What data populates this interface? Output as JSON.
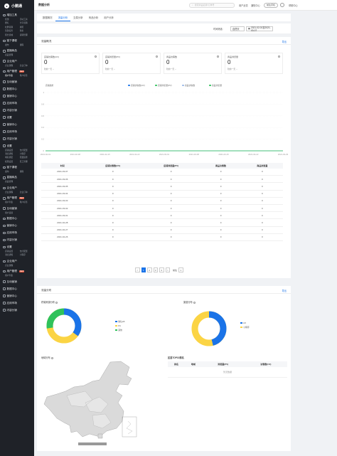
{
  "app": {
    "logo_text": "小鹅通",
    "page_title": "数据分析"
  },
  "topbar": {
    "search_placeholder": "搜索商品名称/订单号",
    "links": [
      "用户反馈",
      "通知中心"
    ],
    "pill": "前往手机",
    "account": "帮助中心"
  },
  "sidebar": {
    "groups": [
      {
        "title": "增加工具",
        "subs": [
          "优惠",
          "活动工具",
          "赠礼",
          "分享营销",
          "社群营销",
          "拼团",
          "奖励任务",
          "秒杀",
          "积分商城",
          "营销管理"
        ]
      },
      {
        "title": "链下课程",
        "subs": [
          "发布",
          "课程"
        ]
      },
      {
        "title": "直播商品",
        "subs": [
          "商品管理"
        ]
      },
      {
        "title": "企业用户",
        "subs": [
          "企业课程",
          "企业订单"
        ]
      },
      {
        "title": "用户管理",
        "badge": "NEW",
        "subs": [
          "用户列表",
          "用户标签"
        ]
      },
      {
        "title": "互动营销",
        "subs": []
      },
      {
        "title": "数据中心",
        "subs": []
      },
      {
        "title": "营销中心",
        "subs": []
      },
      {
        "title": "应用市场",
        "subs": []
      },
      {
        "title": "内容分销",
        "subs": []
      },
      {
        "title": "设置",
        "subs": []
      },
      {
        "title": "营销中心",
        "subs": []
      },
      {
        "title": "应用市场",
        "subs": []
      },
      {
        "title": "内容分销",
        "subs": []
      },
      {
        "title": "设置",
        "subs": [
          "店铺设置",
          "支付配置",
          "消息通知",
          "小程序",
          "域名绑定",
          "页面装修",
          "权限设置",
          "员工管理"
        ]
      },
      {
        "title": "链下课程",
        "subs": [
          "发布",
          "课程"
        ]
      },
      {
        "title": "直播商品",
        "subs": [
          "商品管理"
        ]
      },
      {
        "title": "企业用户",
        "subs": [
          "企业课程",
          "企业订单"
        ]
      },
      {
        "title": "用户管理",
        "badge": "NEW",
        "subs": [
          "用户列表",
          "用户标签"
        ]
      },
      {
        "title": "互动营销",
        "subs": [
          "用户运营"
        ]
      },
      {
        "title": "数据中心",
        "subs": []
      },
      {
        "title": "营销中心",
        "subs": []
      },
      {
        "title": "应用市场",
        "subs": []
      },
      {
        "title": "内容分销",
        "subs": []
      },
      {
        "title": "设置",
        "subs": [
          "店铺设置",
          "支付配置",
          "消息通知",
          "小程序"
        ]
      },
      {
        "title": "企业用户",
        "subs": [
          "企业课程"
        ]
      },
      {
        "title": "用户管理",
        "badge": "NEW",
        "subs": [
          "用户列表"
        ]
      },
      {
        "title": "互动营销",
        "subs": []
      },
      {
        "title": "数据中心",
        "subs": []
      },
      {
        "title": "营销中心",
        "subs": []
      },
      {
        "title": "应用市场",
        "subs": []
      },
      {
        "title": "内容分销",
        "subs": []
      }
    ]
  },
  "tabs": [
    "数据概况",
    "流量分析",
    "交易分析",
    "商品分析",
    "用户分析"
  ],
  "active_tab": 1,
  "filter": {
    "label": "时间筛选:",
    "range": "自然天",
    "date": "2021-02-01至2021-03-07"
  },
  "flow_card": {
    "title": "流量概况",
    "link": "导出",
    "stats": [
      {
        "label": "店铺访客数(UV)",
        "value": "0",
        "compare": "较前一天 --"
      },
      {
        "label": "店铺浏览量(PV)",
        "value": "0",
        "compare": "较前一天 --"
      },
      {
        "label": "商品访客数",
        "value": "0",
        "compare": "较前一天 --"
      },
      {
        "label": "商品浏览量",
        "value": "0",
        "compare": "较前一天 --"
      }
    ],
    "chart_caption": "店铺趋势",
    "legend": [
      "店铺访客数(UV)",
      "店铺浏览量(PV)",
      "商品访客数",
      "商品浏览量"
    ]
  },
  "chart_data": {
    "type": "line",
    "x": [
      "2021-02-01",
      "2021-02-08",
      "2021-02-15",
      "2021-02-22",
      "2021-03-01",
      "2021-03-08",
      "2021-03-15",
      "2021-03-22",
      "2021-03-29"
    ],
    "series": [
      {
        "name": "店铺访客数(UV)",
        "values": [
          0,
          0,
          0,
          0,
          0,
          0,
          0,
          0,
          0
        ]
      },
      {
        "name": "店铺浏览量(PV)",
        "values": [
          0,
          0,
          0,
          0,
          0,
          0,
          0,
          0,
          0
        ]
      },
      {
        "name": "商品访客数",
        "values": [
          0,
          0,
          0,
          0,
          0,
          0,
          0,
          0,
          0
        ]
      },
      {
        "name": "商品浏览量",
        "values": [
          0,
          0,
          0,
          0,
          0,
          0,
          0,
          0,
          0
        ]
      }
    ],
    "yticks": [
      "1",
      "0.8",
      "0.6",
      "0.4",
      "0.2",
      "0"
    ],
    "ylim": [
      0,
      1
    ],
    "grid": true,
    "legend_position": "top-right",
    "colors": [
      "#1a73e8",
      "#2fc25b",
      "#9ab8e8",
      "#2fc25b"
    ]
  },
  "table": {
    "headers": [
      "时间",
      "店铺访客数(UV)",
      "店铺浏览量(PV)",
      "商品访客数",
      "商品浏览量"
    ],
    "rows": [
      [
        "2021-03-07",
        "0",
        "0",
        "0",
        "0"
      ],
      [
        "2021-03-06",
        "0",
        "0",
        "0",
        "0"
      ],
      [
        "2021-03-05",
        "0",
        "0",
        "0",
        "0"
      ],
      [
        "2021-03-04",
        "0",
        "0",
        "0",
        "0"
      ],
      [
        "2021-03-03",
        "0",
        "0",
        "0",
        "0"
      ],
      [
        "2021-03-02",
        "0",
        "0",
        "0",
        "0"
      ],
      [
        "2021-03-01",
        "0",
        "0",
        "0",
        "0"
      ],
      [
        "2021-02-28",
        "0",
        "0",
        "0",
        "0"
      ],
      [
        "2021-02-27",
        "0",
        "0",
        "0",
        "0"
      ],
      [
        "2021-02-26",
        "0",
        "0",
        "0",
        "0"
      ]
    ]
  },
  "pagination": {
    "prev": "<",
    "pages": [
      "1",
      "2",
      "3",
      "4"
    ],
    "active": 0,
    "next": ">",
    "goto_label": "前往",
    "goto_value": "1"
  },
  "dist_card": {
    "title": "流量分布",
    "link": "导出",
    "pie1_title": "终端来源分布",
    "pie1_legend": [
      "微信H5",
      "PC",
      "其他"
    ],
    "pie2_title": "渠道分布",
    "pie2_legend": [
      "H5",
      "小程序"
    ],
    "map_title": "地域分布",
    "top10_title": "区县TOP10排名",
    "top10_headers": [
      "排名",
      "地域",
      "浏览量(PV)",
      "访客数(UV)"
    ],
    "top10_empty": "暂无数据",
    "colors": {
      "blue": "#1a73e8",
      "yellow": "#fbd444",
      "green": "#2fc25b"
    }
  }
}
